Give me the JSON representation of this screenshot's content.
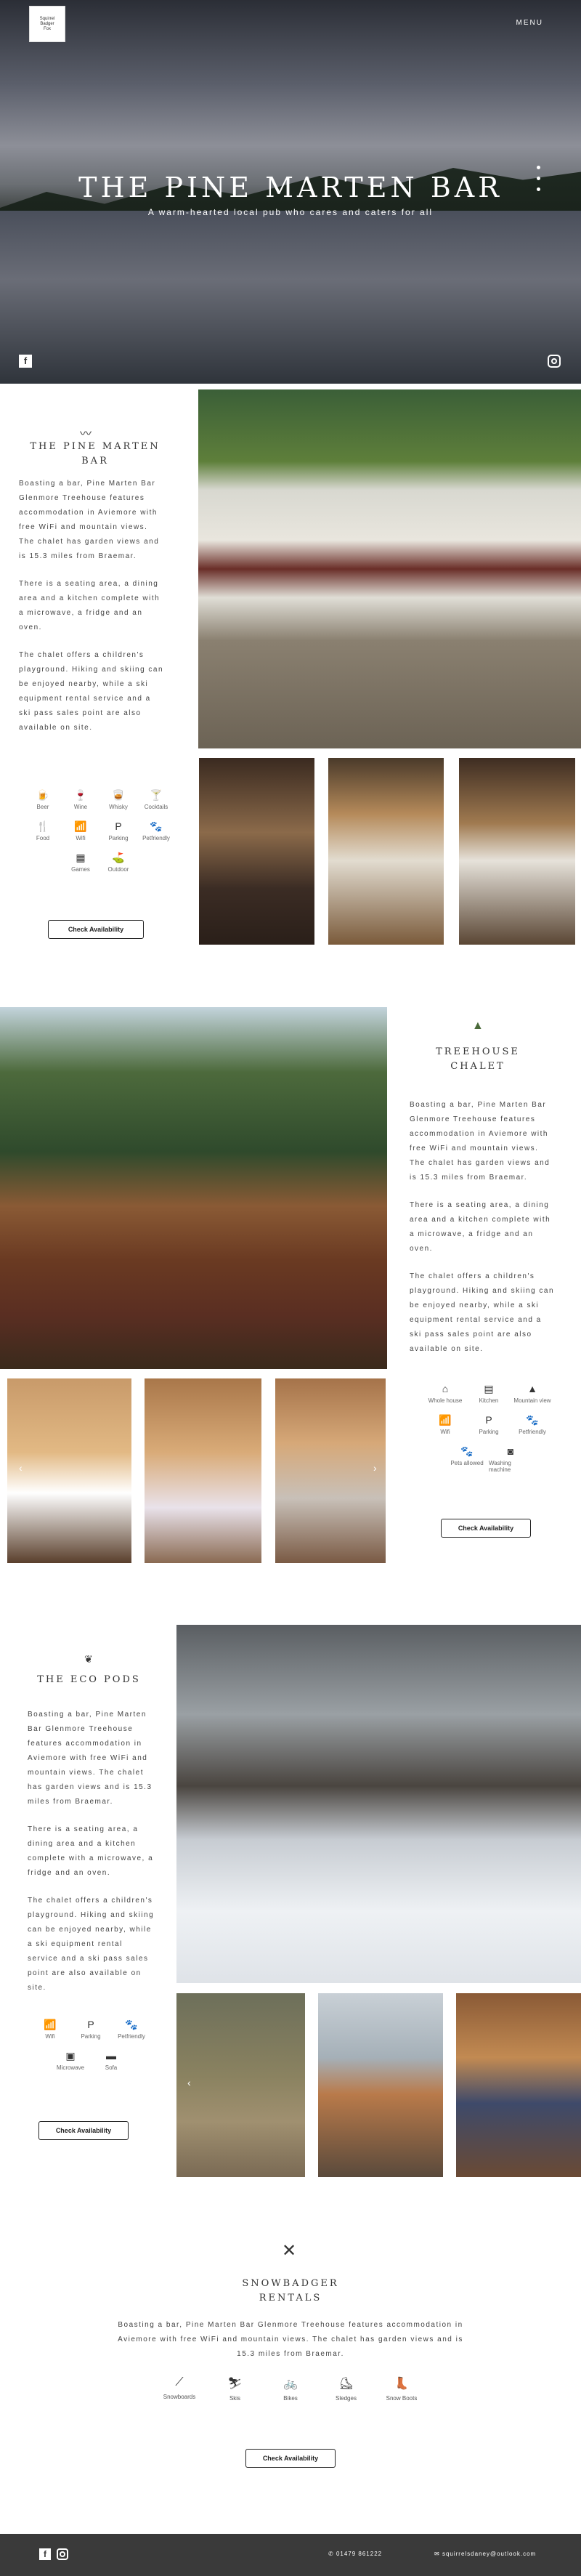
{
  "header": {
    "logo_text": [
      "Squirrel",
      "Badger",
      "Fox"
    ],
    "menu_label": "MENU",
    "hero_title": "THE PINE MARTEN BAR",
    "hero_subtitle": "A warm-hearted local pub who cares and caters for all"
  },
  "pine_marten": {
    "title": "THE PINE MARTEN BAR",
    "paragraphs": [
      "Boasting a bar, Pine Marten Bar Glenmore Treehouse features accommodation in Aviemore with free WiFi and mountain views. The chalet has garden views and is 15.3 miles from Braemar.",
      "There is a seating area, a dining area and a kitchen complete with a microwave, a fridge and an oven.",
      "The chalet offers a children's playground. Hiking and skiing can be enjoyed nearby, while a ski equipment rental service and a ski pass sales point are also available on site."
    ],
    "amenities": [
      {
        "icon": "beer-icon",
        "glyph": "🍺",
        "label": "Beer"
      },
      {
        "icon": "wine-icon",
        "glyph": "🍷",
        "label": "Wine"
      },
      {
        "icon": "whisky-icon",
        "glyph": "🥃",
        "label": "Whisky"
      },
      {
        "icon": "cocktail-icon",
        "glyph": "🍸",
        "label": "Cocktails"
      },
      {
        "icon": "food-icon",
        "glyph": "🍴",
        "label": "Food"
      },
      {
        "icon": "wifi-icon",
        "glyph": "📶",
        "label": "Wifi"
      },
      {
        "icon": "parking-icon",
        "glyph": "P",
        "label": "Parking"
      },
      {
        "icon": "pet-icon",
        "glyph": "🐾",
        "label": "Petfriendly"
      },
      {
        "icon": "games-icon",
        "glyph": "▦",
        "label": "Games"
      },
      {
        "icon": "outdoor-icon",
        "glyph": "⛳",
        "label": "Outdoor"
      }
    ],
    "button": "Check Availability"
  },
  "treehouse": {
    "title_line1": "TREEHOUSE",
    "title_line2": "CHALET",
    "paragraphs": [
      "Boasting a bar, Pine Marten Bar Glenmore Treehouse features accommodation in Aviemore with free WiFi and mountain views. The chalet has garden views and is 15.3 miles from Braemar.",
      "There is a seating area, a dining area and a kitchen complete with a microwave, a fridge and an oven.",
      "The chalet offers a children's playground. Hiking and skiing can be enjoyed nearby, while a ski equipment rental service and a ski pass sales point are also available on site."
    ],
    "amenities": [
      {
        "icon": "house-icon",
        "glyph": "⌂",
        "label": "Whole house"
      },
      {
        "icon": "kitchen-icon",
        "glyph": "▤",
        "label": "Kitchen"
      },
      {
        "icon": "mountain-icon",
        "glyph": "▲",
        "label": "Mountain view"
      },
      {
        "icon": "wifi-icon",
        "glyph": "📶",
        "label": "Wifi"
      },
      {
        "icon": "parking-icon",
        "glyph": "P",
        "label": "Parking"
      },
      {
        "icon": "pet-icon",
        "glyph": "🐾",
        "label": "Petfriendly"
      },
      {
        "icon": "pets-allowed-icon",
        "glyph": "🐾",
        "label": "Pets allowed"
      },
      {
        "icon": "washing-machine-icon",
        "glyph": "◙",
        "label": "Washing machine"
      }
    ],
    "button": "Check Availability"
  },
  "eco_pods": {
    "title": "THE ECO PODS",
    "paragraphs": [
      "Boasting a bar, Pine Marten Bar Glenmore Treehouse features accommodation in Aviemore with free WiFi and mountain views. The chalet has garden views and is 15.3 miles from Braemar.",
      "There is a seating area, a dining area and a kitchen complete with a microwave, a fridge and an oven.",
      "The chalet offers a children's playground. Hiking and skiing can be enjoyed nearby, while a ski equipment rental service and a ski pass sales point are also available on site."
    ],
    "amenities": [
      {
        "icon": "wifi-icon",
        "glyph": "📶",
        "label": "Wifi"
      },
      {
        "icon": "parking-icon",
        "glyph": "P",
        "label": "Parking"
      },
      {
        "icon": "pet-icon",
        "glyph": "🐾",
        "label": "Petfriendly"
      },
      {
        "icon": "microwave-icon",
        "glyph": "▣",
        "label": "Microwave"
      },
      {
        "icon": "sofa-icon",
        "glyph": "▬",
        "label": "Sofa"
      }
    ],
    "button": "Check Availability"
  },
  "snowbadger": {
    "title_line1": "SNOWBADGER",
    "title_line2": "RENTALS",
    "paragraph": "Boasting a bar, Pine Marten Bar Glenmore Treehouse features accommodation in Aviemore with free WiFi and mountain views. The chalet has garden views and is 15.3 miles from Braemar.",
    "items": [
      {
        "icon": "snowboard-icon",
        "glyph": "⟋",
        "label": "Snowboards"
      },
      {
        "icon": "skis-icon",
        "glyph": "⛷",
        "label": "Skis"
      },
      {
        "icon": "bike-icon",
        "glyph": "🚲",
        "label": "Bikes"
      },
      {
        "icon": "sledge-icon",
        "glyph": "⛸",
        "label": "Sledges"
      },
      {
        "icon": "snow-boots-icon",
        "glyph": "👢",
        "label": "Snow Boots"
      }
    ],
    "button": "Check Availability"
  },
  "footer": {
    "phone": "01479 861222",
    "email": "squirrelsdaney@outlook.com"
  }
}
